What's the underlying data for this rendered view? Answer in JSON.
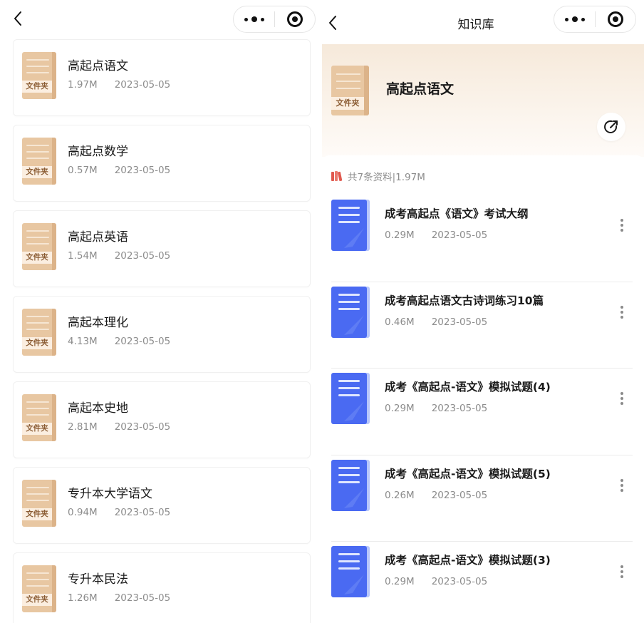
{
  "left_screen": {
    "folders": [
      {
        "name": "高起点语文",
        "size": "1.97M",
        "date": "2023-05-05",
        "tag": "文件夹"
      },
      {
        "name": "高起点数学",
        "size": "0.57M",
        "date": "2023-05-05",
        "tag": "文件夹"
      },
      {
        "name": "高起点英语",
        "size": "1.54M",
        "date": "2023-05-05",
        "tag": "文件夹"
      },
      {
        "name": "高起本理化",
        "size": "4.13M",
        "date": "2023-05-05",
        "tag": "文件夹"
      },
      {
        "name": "高起本史地",
        "size": "2.81M",
        "date": "2023-05-05",
        "tag": "文件夹"
      },
      {
        "name": "专升本大学语文",
        "size": "0.94M",
        "date": "2023-05-05",
        "tag": "文件夹"
      },
      {
        "name": "专升本民法",
        "size": "1.26M",
        "date": "2023-05-05",
        "tag": "文件夹"
      }
    ]
  },
  "right_screen": {
    "title": "知识库",
    "hero": {
      "folder_tag": "文件夹",
      "folder_name": "高起点语文"
    },
    "summary": "共7条资料|1.97M",
    "documents": [
      {
        "title": "成考高起点《语文》考试大纲",
        "size": "0.29M",
        "date": "2023-05-05"
      },
      {
        "title": "成考高起点语文古诗词练习10篇",
        "size": "0.46M",
        "date": "2023-05-05"
      },
      {
        "title": "成考《高起点-语文》模拟试题(4)",
        "size": "0.29M",
        "date": "2023-05-05"
      },
      {
        "title": "成考《高起点-语文》模拟试题(5)",
        "size": "0.26M",
        "date": "2023-05-05"
      },
      {
        "title": "成考《高起点-语文》模拟试题(3)",
        "size": "0.29M",
        "date": "2023-05-05"
      }
    ]
  },
  "icons": {
    "back": "chevron-left-icon",
    "menu": "more-dots-icon",
    "close": "target-close-icon",
    "share": "share-icon",
    "books": "books-icon",
    "doc": "document-icon",
    "row_more": "vertical-dots-icon"
  },
  "colors": {
    "folder": "#e8c7a2",
    "folder_tag_text": "#8a5b32",
    "doc_blue": "#4a6af2",
    "hero_bg": "#f6e9da",
    "books_red": "#e0594f"
  }
}
